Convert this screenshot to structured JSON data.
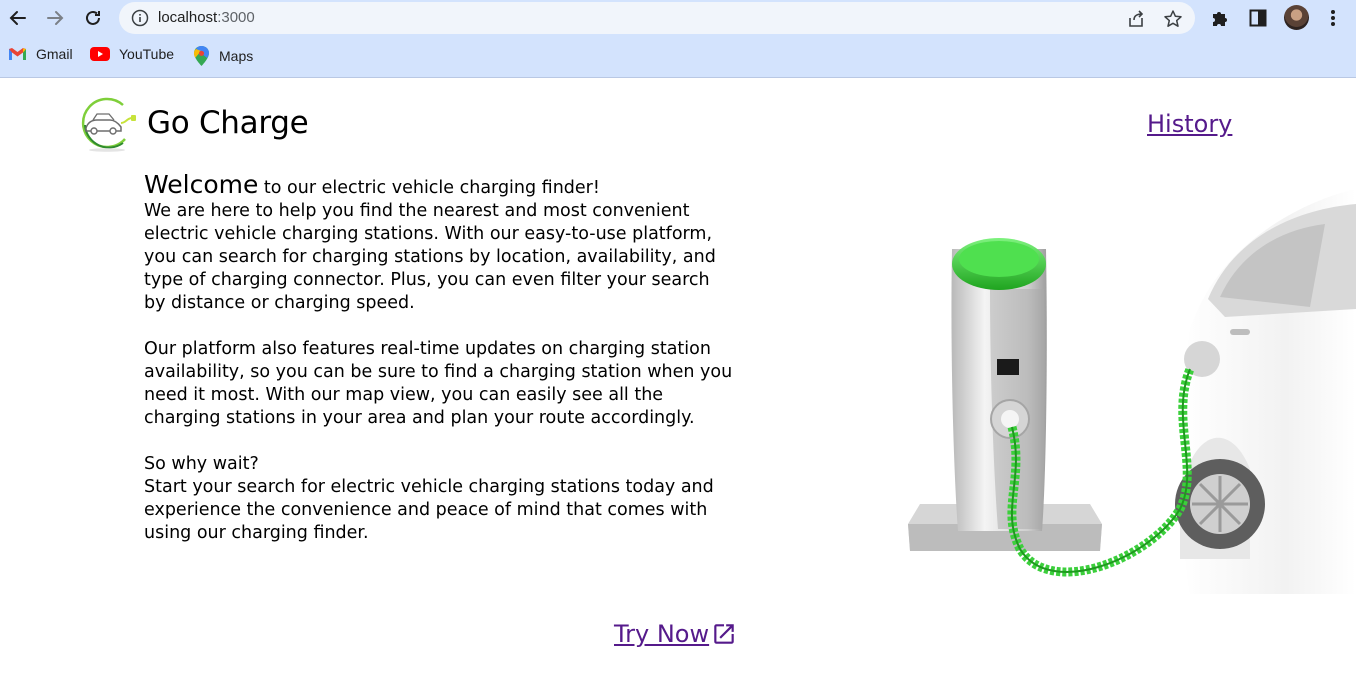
{
  "browser": {
    "url_host": "localhost",
    "url_port": ":3000",
    "bookmarks": [
      {
        "label": "Gmail",
        "icon": "gmail-icon"
      },
      {
        "label": "YouTube",
        "icon": "youtube-icon"
      },
      {
        "label": "Maps",
        "icon": "maps-icon"
      }
    ]
  },
  "header": {
    "brand": "Go Charge",
    "history_link": "History"
  },
  "intro": {
    "welcome_word": "Welcome",
    "welcome_rest": " to our electric vehicle charging finder!",
    "paragraph1": "We are here to help you find the nearest and most convenient electric vehicle charging stations. With our easy-to-use platform, you can search for charging stations by location, availability, and type of charging connector. Plus, you can even filter your search by distance or charging speed.",
    "paragraph2": "Our platform also features real-time updates on charging station availability, so you can be sure to find a charging station when you need it most. With our map view, you can easily see all the charging stations in your area and plan your route accordingly.",
    "paragraph3a": "So why wait?",
    "paragraph3b": "Start your search for electric vehicle charging stations today and experience the convenience and peace of mind that comes with using our charging finder."
  },
  "cta": {
    "try_now": "Try Now",
    "icon": "external-link-icon"
  },
  "colors": {
    "chrome_bg": "#d3e3fd",
    "link_visited": "#551a8b",
    "brand_green": "#3ccf3c"
  }
}
